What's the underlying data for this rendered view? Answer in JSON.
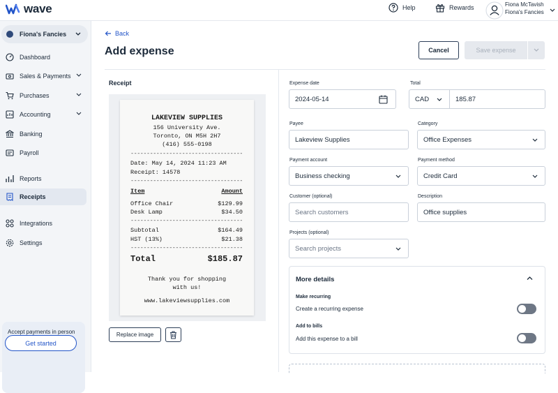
{
  "topbar": {
    "logo_text": "wave",
    "help_label": "Help",
    "rewards_label": "Rewards",
    "user_name": "Fiona McTavish",
    "user_business": "Fiona's Fancies"
  },
  "sidebar": {
    "business_name": "Fiona's Fancies",
    "items": [
      {
        "label": "Dashboard",
        "icon": "dashboard-icon"
      },
      {
        "label": "Sales & Payments",
        "icon": "sales-icon"
      },
      {
        "label": "Purchases",
        "icon": "cart-icon"
      },
      {
        "label": "Accounting",
        "icon": "accounting-icon"
      },
      {
        "label": "Banking",
        "icon": "bank-icon"
      },
      {
        "label": "Payroll",
        "icon": "payroll-icon"
      },
      {
        "label": "Reports",
        "icon": "reports-icon"
      },
      {
        "label": "Receipts",
        "icon": "receipt-icon",
        "active": true
      },
      {
        "label": "Integrations",
        "icon": "integrations-icon"
      },
      {
        "label": "Settings",
        "icon": "gear-icon"
      }
    ],
    "promo": {
      "text": "Accept payments in person and online with Wave.",
      "button": "Get started"
    }
  },
  "page": {
    "back_label": "Back",
    "title": "Add expense",
    "cancel_label": "Cancel",
    "save_label": "Save expense"
  },
  "receipt": {
    "section_label": "Receipt",
    "store": "LAKEVIEW SUPPLIES",
    "address1": "156 University Ave.",
    "address2": "Toronto, ON  M5H 2H7",
    "phone": "(416) 555-0198",
    "date_line": "Date:   May 14, 2024 11:23 AM",
    "receipt_line": "Receipt:  14578",
    "item_header": "Item",
    "amount_header": "Amount",
    "items": [
      {
        "name": "Office Chair",
        "amount": "$129.99"
      },
      {
        "name": "Desk Lamp",
        "amount": "$34.50"
      }
    ],
    "subtotal_label": "Subtotal",
    "subtotal": "$164.49",
    "tax_label": "HST  (13%)",
    "tax": "$21.38",
    "total_label": "Total",
    "total": "$185.87",
    "thanks1": "Thank you for shopping",
    "thanks2": "with us!",
    "website": "www.lakeviewsupplies.com",
    "replace_label": "Replace image"
  },
  "form": {
    "expense_date_label": "Expense date",
    "expense_date": "2024-05-14",
    "total_label": "Total",
    "currency": "CAD",
    "total_value": "185.87",
    "payee_label": "Payee",
    "payee": "Lakeview Supplies",
    "category_label": "Category",
    "category": "Office Expenses",
    "payment_account_label": "Payment account",
    "payment_account": "Business checking",
    "payment_method_label": "Payment method",
    "payment_method": "Credit Card",
    "customer_label": "Customer (optional)",
    "customer_placeholder": "Search customers",
    "description_label": "Description",
    "description": "Office supplies",
    "projects_label": "Projects (optional)",
    "projects_placeholder": "Search projects"
  },
  "more_details": {
    "title": "More details",
    "recurring_label": "Make recurring",
    "recurring_text": "Create a recurring expense",
    "recurring_on": false,
    "bills_label": "Add to bills",
    "bills_text": "Add this expense to a bill",
    "bills_on": false
  }
}
